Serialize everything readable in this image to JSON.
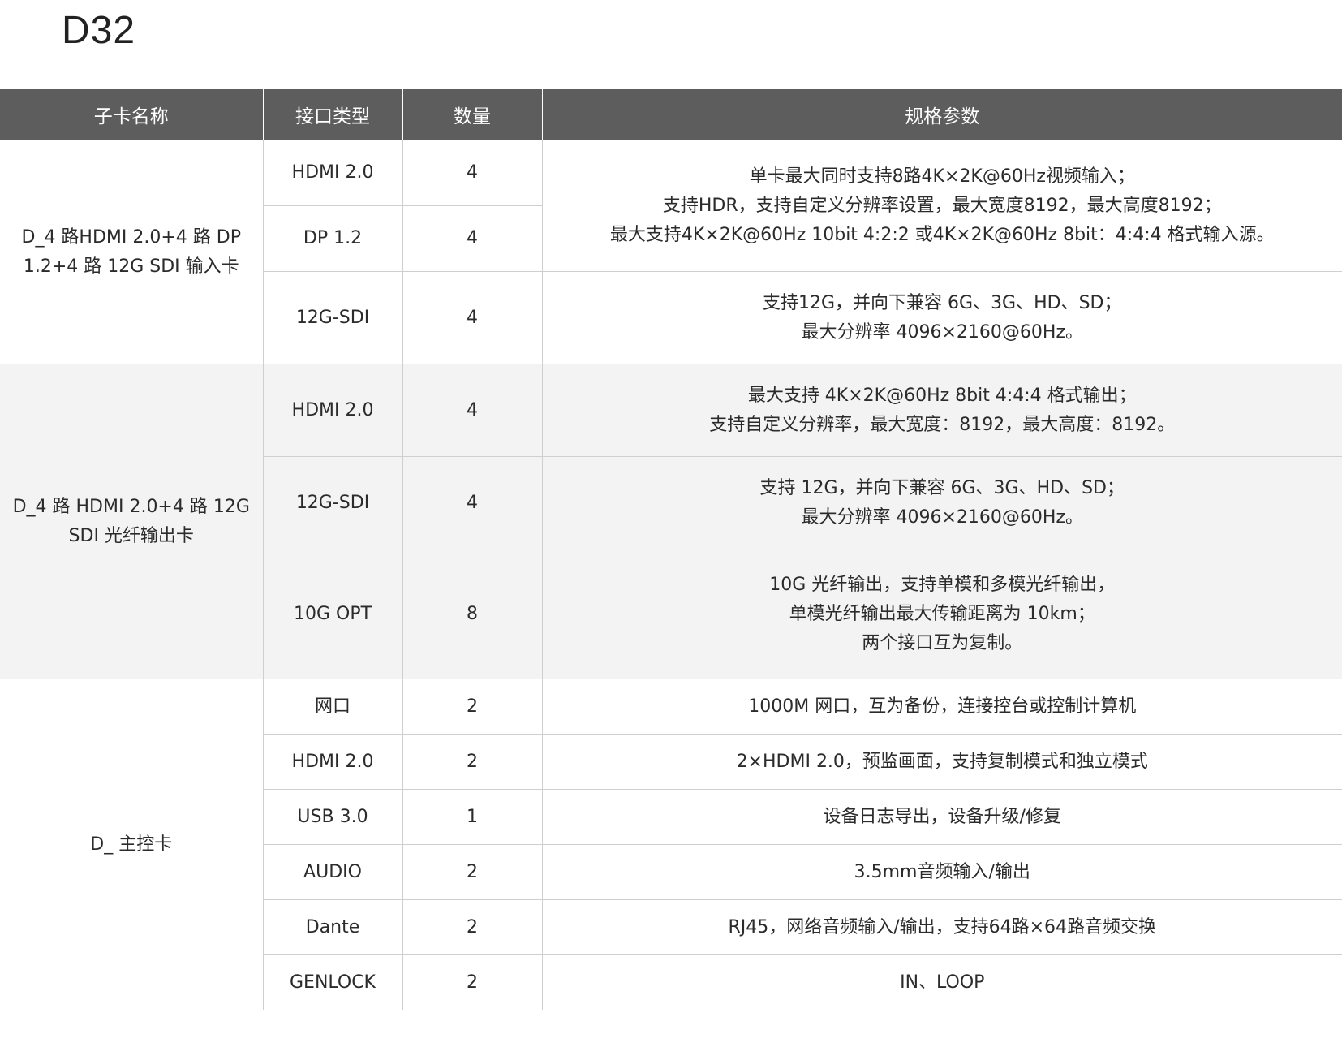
{
  "title": "D32",
  "table": {
    "headers": [
      "子卡名称",
      "接口类型",
      "数量",
      "规格参数"
    ],
    "groups": [
      {
        "name": "D_4 路HDMI 2.0+4 路 DP 1.2+4 路 12G SDI 输入卡",
        "rows": [
          {
            "type": "HDMI 2.0",
            "qty": "4"
          },
          {
            "type": "DP 1.2",
            "qty": "4"
          },
          {
            "type": "12G-SDI",
            "qty": "4"
          }
        ],
        "specs": [
          [
            "单卡最大同时支持8路4K×2K@60Hz视频输入；",
            "支持HDR，支持自定义分辨率设置，最大宽度8192，最大高度8192；",
            "最大支持4K×2K@60Hz 10bit 4:2:2 或4K×2K@60Hz 8bit：4:4:4 格式输入源。"
          ],
          [
            "支持12G，并向下兼容 6G、3G、HD、SD；",
            "最大分辨率 4096×2160@60Hz。"
          ]
        ]
      },
      {
        "name": "D_4 路 HDMI 2.0+4 路 12G SDI 光纤输出卡",
        "rows": [
          {
            "type": "HDMI 2.0",
            "qty": "4"
          },
          {
            "type": "12G-SDI",
            "qty": "4"
          },
          {
            "type": "10G OPT",
            "qty": "8"
          }
        ],
        "specs": [
          [
            "最大支持 4K×2K@60Hz 8bit 4:4:4 格式输出；",
            "支持自定义分辨率，最大宽度：8192，最大高度：8192。"
          ],
          [
            "支持 12G，并向下兼容 6G、3G、HD、SD；",
            "最大分辨率 4096×2160@60Hz。"
          ],
          [
            "10G 光纤输出，支持单模和多模光纤输出，",
            "单模光纤输出最大传输距离为 10km；",
            "两个接口互为复制。"
          ]
        ]
      },
      {
        "name": "D_ 主控卡",
        "rows": [
          {
            "type": "网口",
            "qty": "2",
            "spec": "1000M 网口，互为备份，连接控台或控制计算机"
          },
          {
            "type": "HDMI 2.0",
            "qty": "2",
            "spec": "2×HDMI 2.0，预监画面，支持复制模式和独立模式"
          },
          {
            "type": "USB 3.0",
            "qty": "1",
            "spec": "设备日志导出，设备升级/修复"
          },
          {
            "type": "AUDIO",
            "qty": "2",
            "spec": "3.5mm音频输入/输出"
          },
          {
            "type": "Dante",
            "qty": "2",
            "spec": "RJ45，网络音频输入/输出，支持64路×64路音频交换"
          },
          {
            "type": "GENLOCK",
            "qty": "2",
            "spec": "IN、LOOP"
          }
        ]
      }
    ]
  }
}
